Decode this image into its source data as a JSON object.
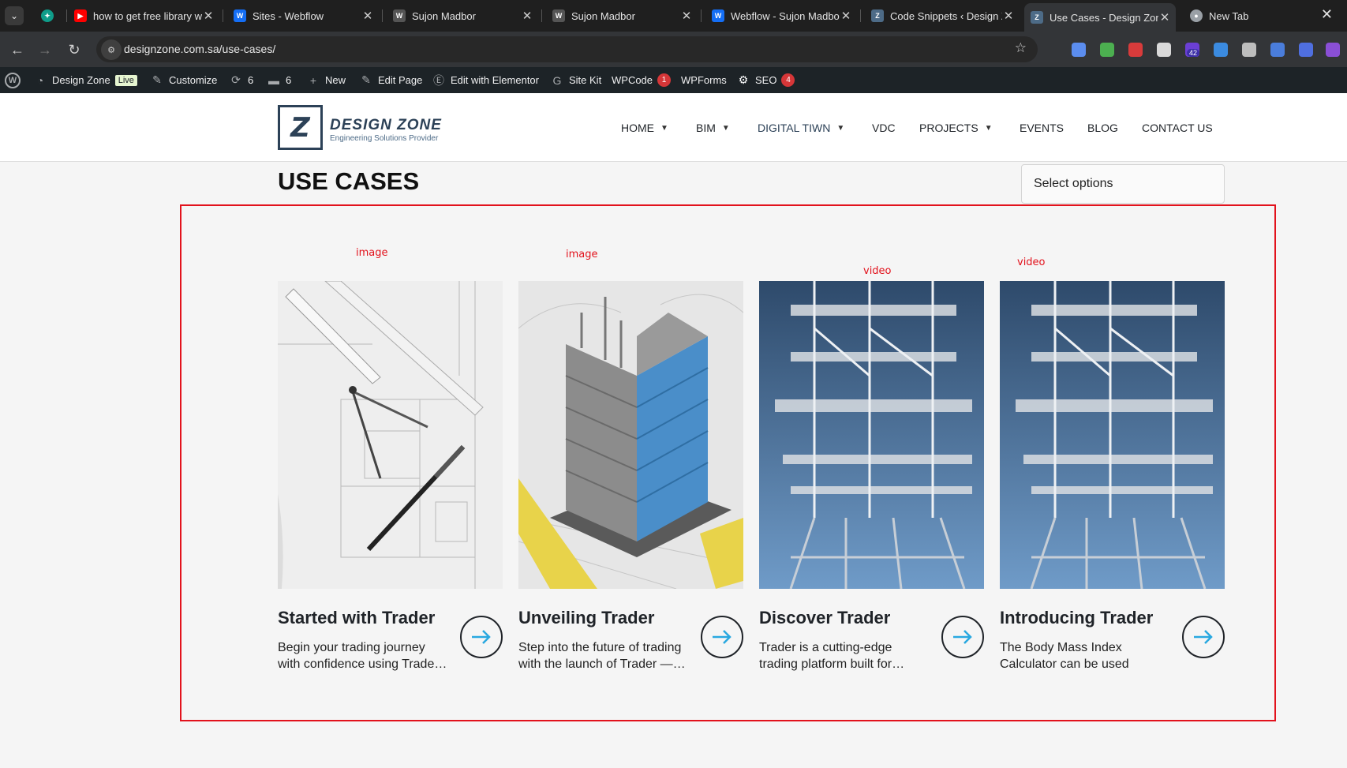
{
  "browser": {
    "tabs": [
      {
        "title": "",
        "icon": "chatgpt-icon",
        "color": "#0f9d8a"
      },
      {
        "title": "how to get free library w",
        "icon": "youtube-icon",
        "color": "#ff0000"
      },
      {
        "title": "Sites - Webflow",
        "icon": "webflow-icon",
        "color": "#146ef5"
      },
      {
        "title": "Sujon Madbor",
        "icon": "webflow-icon",
        "color": "#555555"
      },
      {
        "title": "Sujon Madbor",
        "icon": "webflow-icon",
        "color": "#555555"
      },
      {
        "title": "Webflow - Sujon Madbo",
        "icon": "webflow-icon",
        "color": "#146ef5"
      },
      {
        "title": "Code Snippets ‹ Design Z",
        "icon": "designzone-icon",
        "color": "#4d6b87"
      },
      {
        "title": "Use Cases - Design Zone",
        "icon": "designzone-icon",
        "color": "#4d6b87",
        "active": true
      },
      {
        "title": "New Tab",
        "icon": "chrome-icon",
        "color": "#9aa0a6"
      }
    ],
    "url": "designzone.com.sa/use-cases/",
    "extension_badge": "42"
  },
  "adminbar": {
    "site_name": "Design Zone",
    "live": "Live",
    "customize": "Customize",
    "updates": "6",
    "comments": "6",
    "new": "New",
    "edit_page": "Edit Page",
    "elementor": "Edit with Elementor",
    "sitekit": "Site Kit",
    "wpcode": "WPCode",
    "wpcode_count": "1",
    "wpforms": "WPForms",
    "seo": "SEO",
    "seo_count": "4"
  },
  "site": {
    "logo_name": "DESIGN ZONE",
    "logo_tagline": "Engineering Solutions Provider",
    "nav": [
      {
        "label": "HOME",
        "dropdown": true
      },
      {
        "label": "BIM",
        "dropdown": true
      },
      {
        "label": "DIGITAL TIWN",
        "dropdown": true
      },
      {
        "label": "VDC",
        "dropdown": false
      },
      {
        "label": "PROJECTS",
        "dropdown": true
      },
      {
        "label": "EVENTS",
        "dropdown": false
      },
      {
        "label": "BLOG",
        "dropdown": false
      },
      {
        "label": "CONTACT US",
        "dropdown": false
      }
    ]
  },
  "page": {
    "title": "USE CASES",
    "select_label": "Select options"
  },
  "annotations": {
    "card1": "image",
    "card2": "image",
    "card3": "video",
    "card4": "video",
    "border_color": "#e2121c"
  },
  "cards": [
    {
      "title": "Started with Trader",
      "desc1": "Begin your trading journey",
      "desc2": "with confidence using Trade…",
      "media": "drafting-tools-image"
    },
    {
      "title": "Unveiling Trader",
      "desc1": "Step into the future of trading",
      "desc2": "with the launch of Trader —…",
      "media": "building-model-image"
    },
    {
      "title": "Discover Trader",
      "desc1": "Trader is a cutting-edge",
      "desc2": "trading platform built for…",
      "media": "offshore-structure-video"
    },
    {
      "title": "Introducing Trader",
      "desc1": "The Body Mass Index",
      "desc2": "Calculator can be used",
      "media": "offshore-structure-video"
    }
  ],
  "accent_color": "#29a8e0"
}
